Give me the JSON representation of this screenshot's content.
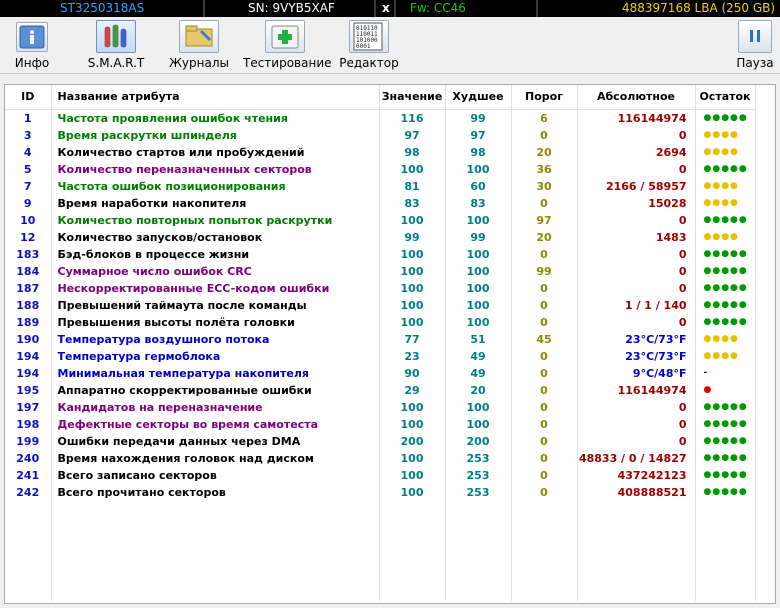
{
  "topbar": {
    "model": "ST3250318AS",
    "serial": "SN: 9VYB5XAF",
    "close": "x",
    "firmware": "Fw: CC46",
    "lba": "488397168 LBA (250 GB)"
  },
  "toolbar": {
    "info": "Инфо",
    "smart": "S.M.A.R.T",
    "logs": "Журналы",
    "test": "Тестирование",
    "editor": "Редактор",
    "pause": "Пауза",
    "editor_icon_text": "010110\n110011\n101000\n0001"
  },
  "colors": {
    "green": "#008000",
    "purple": "#800080",
    "blue": "#0000cc",
    "black": "#000000",
    "dot_green": "#009a00",
    "dot_yellow": "#e8c000",
    "dot_red": "#e00000"
  },
  "table": {
    "headers": [
      "ID",
      "Название атрибута",
      "Значение",
      "Худшее",
      "Порог",
      "Абсолютное",
      "Остаток"
    ],
    "rows": [
      {
        "id": "1",
        "name": "Частота проявления ошибок чтения",
        "name_color": "green",
        "value": "116",
        "worst": "99",
        "threshold": "6",
        "raw": "116144974",
        "remain": "●●●●●",
        "remain_color": "dot_green"
      },
      {
        "id": "3",
        "name": "Время раскрутки шпинделя",
        "name_color": "green",
        "value": "97",
        "worst": "97",
        "threshold": "0",
        "raw": "0",
        "remain": "●●●●",
        "remain_color": "dot_yellow"
      },
      {
        "id": "4",
        "name": "Количество стартов или пробуждений",
        "name_color": "black",
        "value": "98",
        "worst": "98",
        "threshold": "20",
        "raw": "2694",
        "remain": "●●●●",
        "remain_color": "dot_yellow"
      },
      {
        "id": "5",
        "name": "Количество переназначенных секторов",
        "name_color": "purple",
        "value": "100",
        "worst": "100",
        "threshold": "36",
        "raw": "0",
        "remain": "●●●●●",
        "remain_color": "dot_green"
      },
      {
        "id": "7",
        "name": "Частота ошибок позиционирования",
        "name_color": "green",
        "value": "81",
        "worst": "60",
        "threshold": "30",
        "raw": "2166 / 58957",
        "remain": "●●●●",
        "remain_color": "dot_yellow"
      },
      {
        "id": "9",
        "name": "Время наработки накопителя",
        "name_color": "black",
        "value": "83",
        "worst": "83",
        "threshold": "0",
        "raw": "15028",
        "remain": "●●●●",
        "remain_color": "dot_yellow"
      },
      {
        "id": "10",
        "name": "Количество повторных попыток раскрутки",
        "name_color": "green",
        "value": "100",
        "worst": "100",
        "threshold": "97",
        "raw": "0",
        "remain": "●●●●●",
        "remain_color": "dot_green"
      },
      {
        "id": "12",
        "name": "Количество запусков/остановок",
        "name_color": "black",
        "value": "99",
        "worst": "99",
        "threshold": "20",
        "raw": "1483",
        "remain": "●●●●",
        "remain_color": "dot_yellow"
      },
      {
        "id": "183",
        "name": "Бэд-блоков в процессе жизни",
        "name_color": "black",
        "value": "100",
        "worst": "100",
        "threshold": "0",
        "raw": "0",
        "remain": "●●●●●",
        "remain_color": "dot_green"
      },
      {
        "id": "184",
        "name": "Суммарное число ошибок CRC",
        "name_color": "purple",
        "value": "100",
        "worst": "100",
        "threshold": "99",
        "raw": "0",
        "remain": "●●●●●",
        "remain_color": "dot_green"
      },
      {
        "id": "187",
        "name": "Нескорректированные ECC-кодом ошибки",
        "name_color": "purple",
        "value": "100",
        "worst": "100",
        "threshold": "0",
        "raw": "0",
        "remain": "●●●●●",
        "remain_color": "dot_green"
      },
      {
        "id": "188",
        "name": "Превышений таймаута после команды",
        "name_color": "black",
        "value": "100",
        "worst": "100",
        "threshold": "0",
        "raw": "1 / 1 / 140",
        "remain": "●●●●●",
        "remain_color": "dot_green"
      },
      {
        "id": "189",
        "name": "Превышения высоты полёта головки",
        "name_color": "black",
        "value": "100",
        "worst": "100",
        "threshold": "0",
        "raw": "0",
        "remain": "●●●●●",
        "remain_color": "dot_green"
      },
      {
        "id": "190",
        "name": "Температура воздушного потока",
        "name_color": "blue",
        "value": "77",
        "worst": "51",
        "threshold": "45",
        "raw": "23°C/73°F",
        "raw_color": "blue",
        "remain": "●●●●",
        "remain_color": "dot_yellow"
      },
      {
        "id": "194",
        "name": "Температура гермоблока",
        "name_color": "blue",
        "value": "23",
        "worst": "49",
        "threshold": "0",
        "raw": "23°C/73°F",
        "raw_color": "blue",
        "remain": "●●●●",
        "remain_color": "dot_yellow"
      },
      {
        "id": "194",
        "name": "Минимальная температура накопителя",
        "name_color": "blue",
        "value": "90",
        "worst": "49",
        "threshold": "0",
        "raw": "9°C/48°F",
        "raw_color": "blue",
        "remain": "-",
        "remain_color": "blue"
      },
      {
        "id": "195",
        "name": "Аппаратно скорректированные ошибки",
        "name_color": "black",
        "value": "29",
        "worst": "20",
        "threshold": "0",
        "raw": "116144974",
        "remain": "●",
        "remain_color": "dot_red"
      },
      {
        "id": "197",
        "name": "Кандидатов на переназначение",
        "name_color": "purple",
        "value": "100",
        "worst": "100",
        "threshold": "0",
        "raw": "0",
        "remain": "●●●●●",
        "remain_color": "dot_green"
      },
      {
        "id": "198",
        "name": "Дефектные секторы во время самотеста",
        "name_color": "purple",
        "value": "100",
        "worst": "100",
        "threshold": "0",
        "raw": "0",
        "remain": "●●●●●",
        "remain_color": "dot_green"
      },
      {
        "id": "199",
        "name": "Ошибки передачи данных через DMA",
        "name_color": "black",
        "value": "200",
        "worst": "200",
        "threshold": "0",
        "raw": "0",
        "remain": "●●●●●",
        "remain_color": "dot_green"
      },
      {
        "id": "240",
        "name": "Время нахождения головок над диском",
        "name_color": "black",
        "value": "100",
        "worst": "253",
        "threshold": "0",
        "raw": "48833 / 0 / 14827",
        "remain": "●●●●●",
        "remain_color": "dot_green"
      },
      {
        "id": "241",
        "name": "Всего записано секторов",
        "name_color": "black",
        "value": "100",
        "worst": "253",
        "threshold": "0",
        "raw": "437242123",
        "remain": "●●●●●",
        "remain_color": "dot_green"
      },
      {
        "id": "242",
        "name": "Всего прочитано секторов",
        "name_color": "black",
        "value": "100",
        "worst": "253",
        "threshold": "0",
        "raw": "408888521",
        "remain": "●●●●●",
        "remain_color": "dot_green"
      }
    ]
  }
}
